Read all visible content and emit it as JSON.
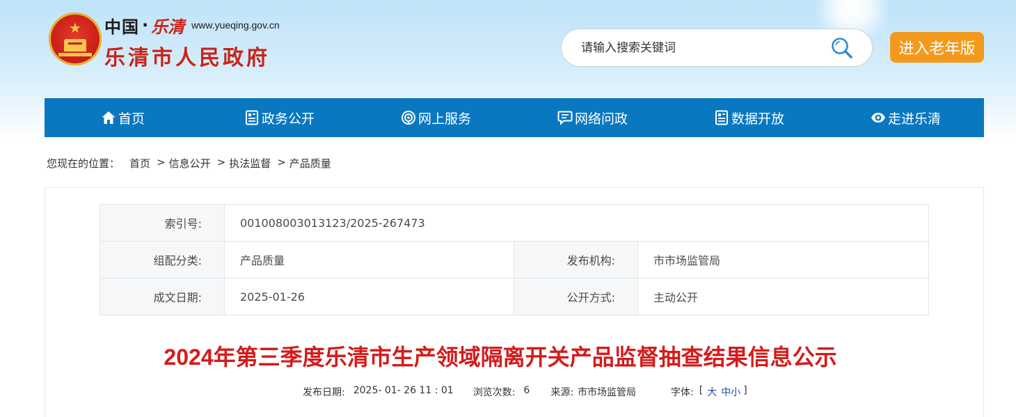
{
  "header": {
    "china_text": "中国",
    "dot": "·",
    "leqing_text": "乐清",
    "url": "www.yueqing.gov.cn",
    "gov_name": "乐清市人民政府"
  },
  "search": {
    "placeholder": "请输入搜索关键词"
  },
  "elder_button": "进入老年版",
  "nav": [
    {
      "label": "首页",
      "icon": "home-icon"
    },
    {
      "label": "政务公开",
      "icon": "document-icon"
    },
    {
      "label": "网上服务",
      "icon": "service-icon"
    },
    {
      "label": "网络问政",
      "icon": "chat-icon"
    },
    {
      "label": "数据开放",
      "icon": "data-icon"
    },
    {
      "label": "走进乐清",
      "icon": "eye-icon"
    }
  ],
  "breadcrumb": {
    "prefix": "您现在的位置：",
    "items": [
      "首页",
      "信息公开",
      "执法监督",
      "产品质量"
    ],
    "sep": ">"
  },
  "meta": {
    "index_label": "索引号:",
    "index_value": "001008003013123/2025-267473",
    "category_label": "组配分类:",
    "category_value": "产品质量",
    "publisher_label": "发布机构:",
    "publisher_value": "市市场监管局",
    "date_label": "成文日期:",
    "date_value": "2025-01-26",
    "method_label": "公开方式:",
    "method_value": "主动公开"
  },
  "article": {
    "title": "2024年第三季度乐清市生产领域隔离开关产品监督抽查结果信息公示",
    "publish_date_label": "发布日期:",
    "publish_date": "2025- 01- 26 11 : 01",
    "views_label": "浏览次数:",
    "views": "6",
    "source_label": "来源:",
    "source": "市市场监管局",
    "font_label": "字体:",
    "bracket_open": "[",
    "font_large": "大",
    "font_medium": "中",
    "font_small": "小",
    "bracket_close": "]"
  },
  "colors": {
    "nav_bg": "#0a78c0",
    "title_red": "#d41b1b",
    "elder_orange": "#f39a1d",
    "gov_red": "#c8241a"
  }
}
